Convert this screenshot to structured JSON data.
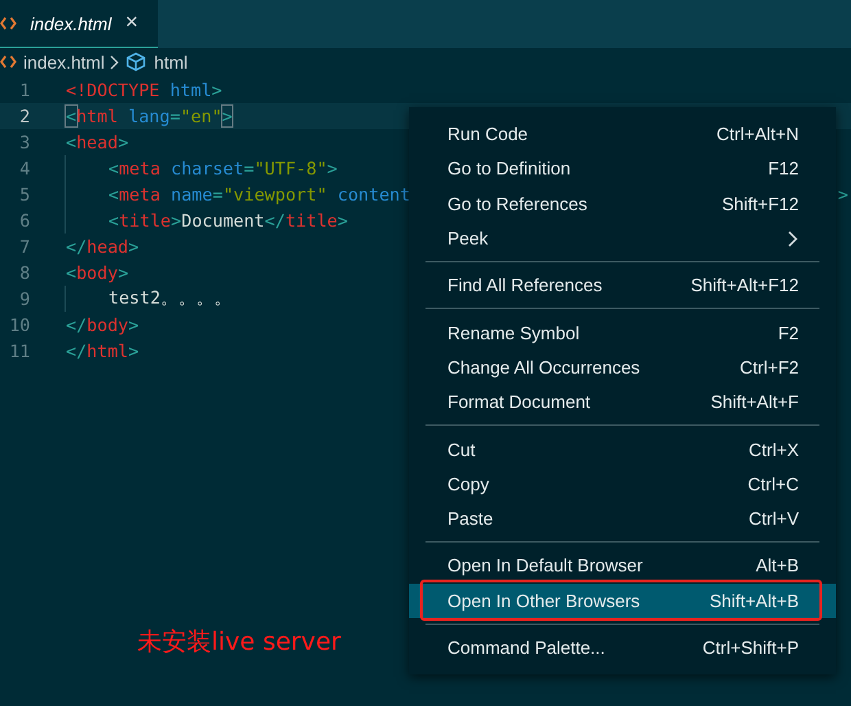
{
  "tabs": [
    {
      "label": "index.html",
      "selected": true,
      "close": "×"
    }
  ],
  "breadcrumb": [
    {
      "label": "index.html",
      "kind": "file"
    },
    {
      "label": "html",
      "kind": "symbol"
    }
  ],
  "code_lines": [
    {
      "number": "1",
      "current": false,
      "tokens": [
        {
          "text": "<!DOCTYPE",
          "kind": "keyword"
        },
        {
          "text": " html",
          "kind": "attr"
        },
        {
          "text": ">",
          "kind": "punct"
        }
      ]
    },
    {
      "number": "2",
      "current": true,
      "tokens": [
        {
          "text": "<",
          "kind": "punct",
          "matched": true
        },
        {
          "text": "html",
          "kind": "tag"
        },
        {
          "text": " lang",
          "kind": "attr"
        },
        {
          "text": "=",
          "kind": "punct"
        },
        {
          "text": "\"en\"",
          "kind": "string"
        },
        {
          "text": ">",
          "kind": "punct",
          "matched": true
        }
      ]
    },
    {
      "number": "3",
      "current": false,
      "tokens": [
        {
          "text": "<",
          "kind": "punct"
        },
        {
          "text": "head",
          "kind": "tag"
        },
        {
          "text": ">",
          "kind": "punct"
        }
      ],
      "children": [
        {
          "number": "4",
          "current": false,
          "tokens": [
            {
              "text": "<",
              "kind": "punct"
            },
            {
              "text": "meta",
              "kind": "tag"
            },
            {
              "text": " charset",
              "kind": "attr"
            },
            {
              "text": "=",
              "kind": "punct"
            },
            {
              "text": "\"UTF-8\"",
              "kind": "string"
            },
            {
              "text": ">",
              "kind": "punct"
            }
          ]
        },
        {
          "number": "5",
          "current": false,
          "tokens": [
            {
              "text": "<",
              "kind": "punct"
            },
            {
              "text": "meta",
              "kind": "tag"
            },
            {
              "text": " name",
              "kind": "attr"
            },
            {
              "text": "=",
              "kind": "punct"
            },
            {
              "text": "\"viewport\"",
              "kind": "string"
            },
            {
              "text": " content",
              "kind": "attr"
            }
          ],
          "tail": ">"
        },
        {
          "number": "6",
          "current": false,
          "tokens": [
            {
              "text": "<",
              "kind": "punct"
            },
            {
              "text": "title",
              "kind": "tag"
            },
            {
              "text": ">",
              "kind": "punct"
            },
            {
              "text": "Document",
              "kind": "text"
            },
            {
              "text": "</",
              "kind": "punct"
            },
            {
              "text": "title",
              "kind": "tag"
            },
            {
              "text": ">",
              "kind": "punct"
            }
          ]
        }
      ]
    },
    {
      "number": "7",
      "current": false,
      "tokens": [
        {
          "text": "</",
          "kind": "punct"
        },
        {
          "text": "head",
          "kind": "tag"
        },
        {
          "text": ">",
          "kind": "punct"
        }
      ]
    },
    {
      "number": "8",
      "current": false,
      "tokens": [
        {
          "text": "<",
          "kind": "punct"
        },
        {
          "text": "body",
          "kind": "tag"
        },
        {
          "text": ">",
          "kind": "punct"
        }
      ],
      "children": [
        {
          "number": "9",
          "current": false,
          "tokens": [
            {
              "text": "test2。。。。",
              "kind": "text"
            }
          ]
        }
      ]
    },
    {
      "number": "10",
      "current": false,
      "tokens": [
        {
          "text": "</",
          "kind": "punct"
        },
        {
          "text": "body",
          "kind": "tag"
        },
        {
          "text": ">",
          "kind": "punct"
        }
      ]
    },
    {
      "number": "11",
      "current": false,
      "tokens": [
        {
          "text": "</",
          "kind": "punct"
        },
        {
          "text": "html",
          "kind": "tag"
        },
        {
          "text": ">",
          "kind": "punct"
        }
      ]
    }
  ],
  "context_menu": {
    "groups": [
      [
        {
          "label": "Run Code",
          "shortcut": "Ctrl+Alt+N",
          "selected": false
        },
        {
          "label": "Go to Definition",
          "shortcut": "F12",
          "selected": false
        },
        {
          "label": "Go to References",
          "shortcut": "Shift+F12",
          "selected": false
        },
        {
          "label": "Peek",
          "submenu": true,
          "selected": false
        }
      ],
      [
        {
          "label": "Find All References",
          "shortcut": "Shift+Alt+F12",
          "selected": false
        }
      ],
      [
        {
          "label": "Rename Symbol",
          "shortcut": "F2",
          "selected": false
        },
        {
          "label": "Change All Occurrences",
          "shortcut": "Ctrl+F2",
          "selected": false
        },
        {
          "label": "Format Document",
          "shortcut": "Shift+Alt+F",
          "selected": false
        }
      ],
      [
        {
          "label": "Cut",
          "shortcut": "Ctrl+X",
          "selected": false
        },
        {
          "label": "Copy",
          "shortcut": "Ctrl+C",
          "selected": false
        },
        {
          "label": "Paste",
          "shortcut": "Ctrl+V",
          "selected": false
        }
      ],
      [
        {
          "label": "Open In Default Browser",
          "shortcut": "Alt+B",
          "selected": false
        },
        {
          "label": "Open In Other Browsers",
          "shortcut": "Shift+Alt+B",
          "selected": true,
          "boxed": true
        }
      ],
      [
        {
          "label": "Command Palette...",
          "shortcut": "Ctrl+Shift+P",
          "selected": false
        }
      ]
    ]
  },
  "annotation": {
    "note": "未安装live server"
  }
}
